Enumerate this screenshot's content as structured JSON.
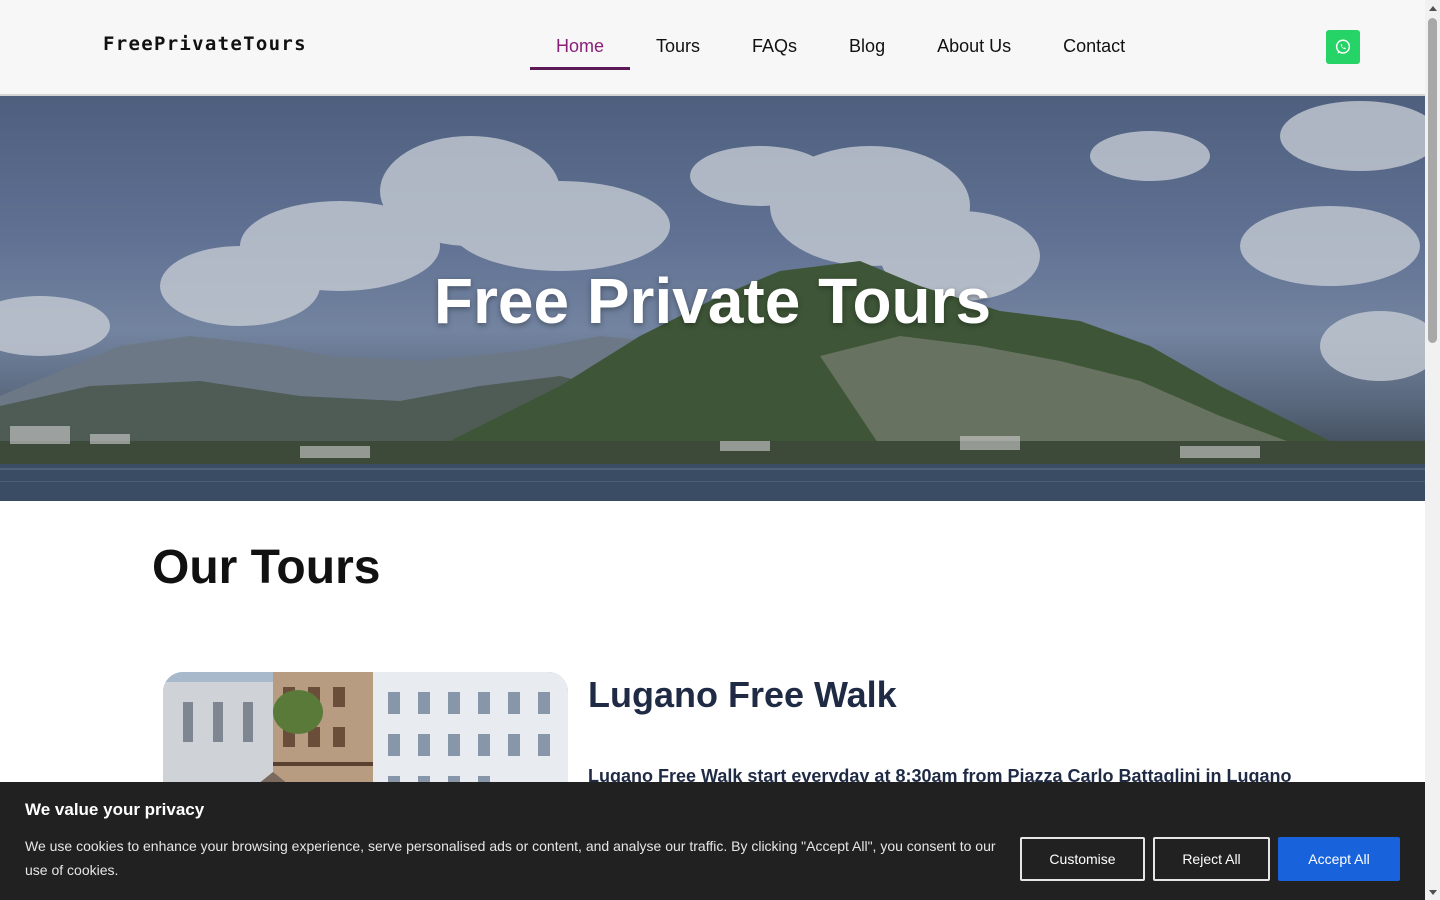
{
  "header": {
    "logo": "FreePrivateTours",
    "nav": [
      {
        "label": "Home",
        "active": true
      },
      {
        "label": "Tours",
        "active": false
      },
      {
        "label": "FAQs",
        "active": false
      },
      {
        "label": "Blog",
        "active": false
      },
      {
        "label": "About Us",
        "active": false
      },
      {
        "label": "Contact",
        "active": false
      }
    ],
    "whatsapp_icon": "whatsapp-icon",
    "accent_color": "#8a1f7a",
    "whatsapp_color": "#25d366"
  },
  "hero": {
    "title": "Free Private Tours"
  },
  "main": {
    "section_title": "Our Tours",
    "tours": [
      {
        "title": "Lugano Free Walk",
        "description": "Lugano Free Walk start everyday at 8:30am from Piazza Carlo Battaglini in Lugano"
      }
    ]
  },
  "cookie": {
    "title": "We value your privacy",
    "text": "We use cookies to enhance your browsing experience, serve personalised ads or content, and analyse our traffic. By clicking \"Accept All\", you consent to our use of cookies.",
    "customise": "Customise",
    "reject": "Reject All",
    "accept": "Accept All",
    "accept_color": "#1863dc"
  }
}
